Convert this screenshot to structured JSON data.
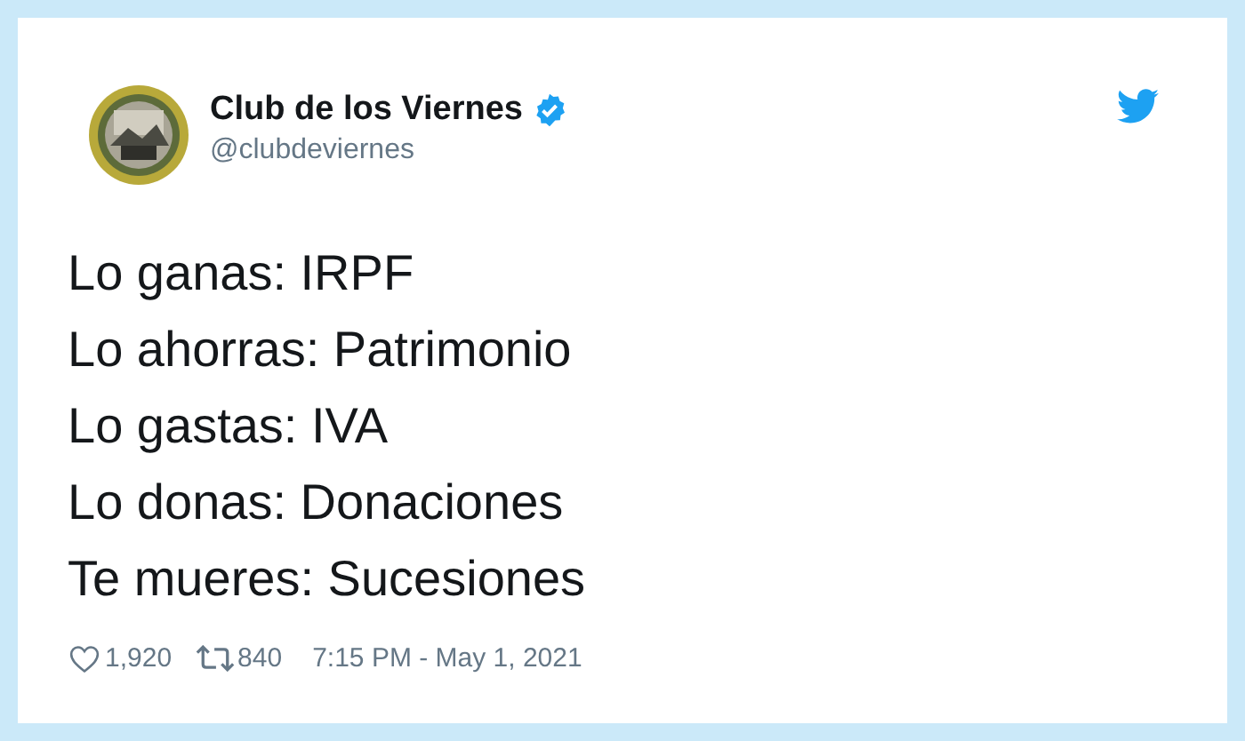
{
  "author": {
    "name": "Club de los Viernes",
    "verified": true,
    "handle": "@clubdeviernes"
  },
  "lines": [
    "Lo ganas: IRPF",
    "Lo ahorras: Patrimonio",
    "Lo gastas: IVA",
    "Lo donas: Donaciones",
    "Te mueres: Sucesiones"
  ],
  "footer": {
    "likes": "1,920",
    "retweets": "840",
    "timestamp": "7:15 PM - May 1, 2021"
  }
}
